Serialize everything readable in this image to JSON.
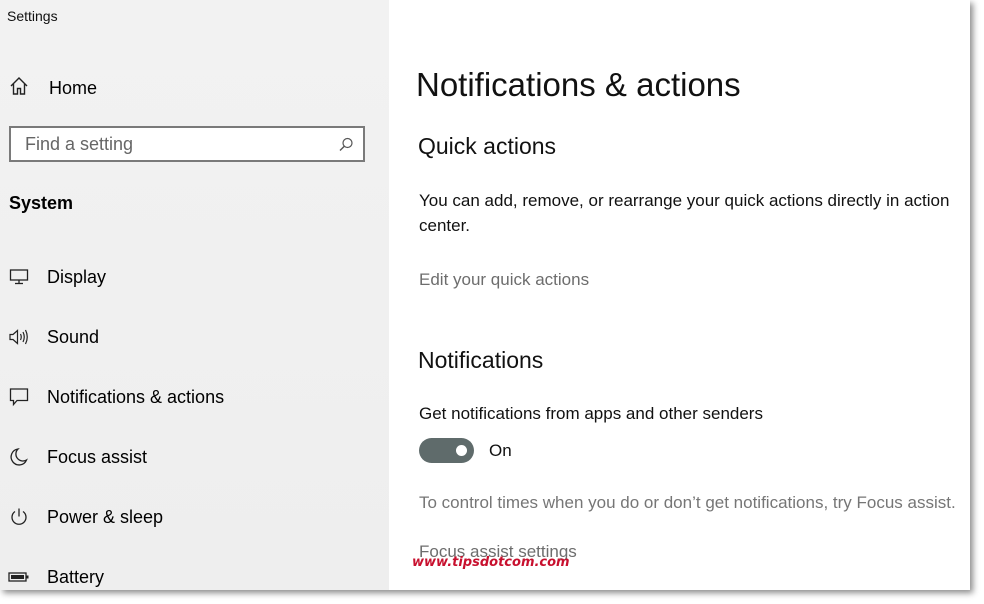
{
  "window": {
    "title": "Settings"
  },
  "sidebar": {
    "home": {
      "label": "Home",
      "icon": "home-icon"
    },
    "search": {
      "placeholder": "Find a setting",
      "icon": "search-icon"
    },
    "section": "System",
    "items": [
      {
        "label": "Display",
        "icon": "display-icon"
      },
      {
        "label": "Sound",
        "icon": "speaker-icon"
      },
      {
        "label": "Notifications & actions",
        "icon": "chat-bubble-icon",
        "selected": true
      },
      {
        "label": "Focus assist",
        "icon": "moon-icon"
      },
      {
        "label": "Power & sleep",
        "icon": "power-icon"
      },
      {
        "label": "Battery",
        "icon": "battery-icon"
      }
    ]
  },
  "main": {
    "title": "Notifications & actions",
    "quick_actions": {
      "heading": "Quick actions",
      "description": "You can add, remove, or rearrange your quick actions directly in action center.",
      "link": "Edit your quick actions"
    },
    "notifications": {
      "heading": "Notifications",
      "toggle_label": "Get notifications from apps and other senders",
      "toggle_state": "On",
      "toggle_on": true,
      "focus_hint": "To control times when you do or don’t get notifications, try Focus assist.",
      "focus_link": "Focus assist settings"
    }
  },
  "watermark": "www.tipsdotcom.com",
  "colors": {
    "toggle_on": "#5f6b6b",
    "link": "#6d6d6d",
    "watermark": "#c8102e"
  }
}
